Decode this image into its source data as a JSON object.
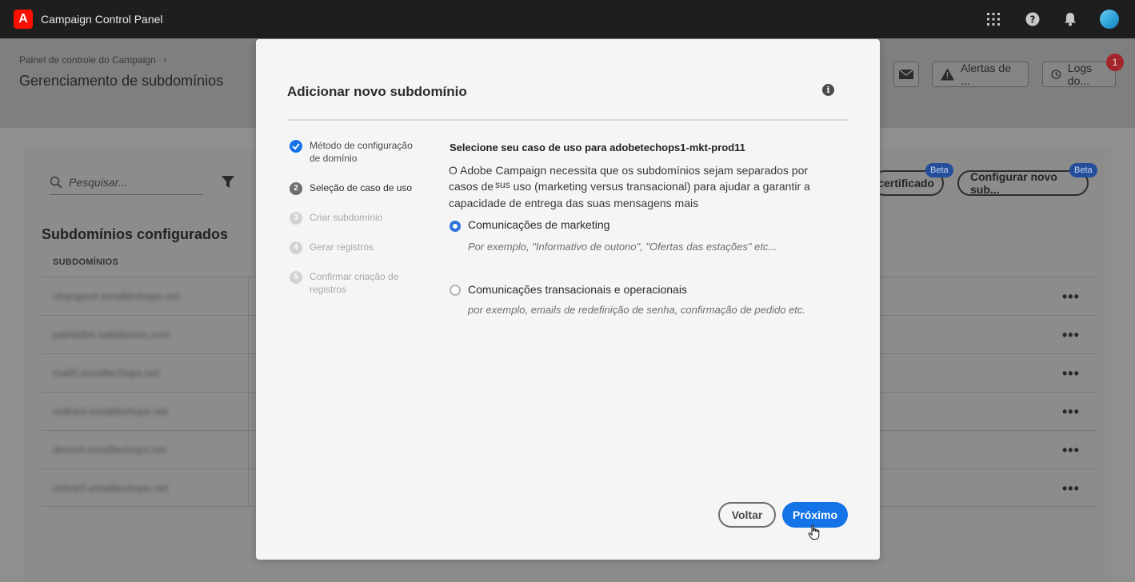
{
  "app": {
    "logo": "A",
    "title": "Campaign Control Panel"
  },
  "topbar_icons": [
    "apps-grid-icon",
    "help-icon",
    "bell-icon"
  ],
  "page": {
    "breadcrumb": "Painel de controle do Campaign",
    "title": "Gerenciamento de subdomínios",
    "header_buttons": {
      "alerts": "Alertas de ...",
      "logs": "Logs do..."
    },
    "logs_badge": "1"
  },
  "main": {
    "search_placeholder": "Pesquisar...",
    "cert_button": "certificado",
    "configure_button": "Configurar novo sub...",
    "beta_label": "Beta",
    "section_title": "Subdomínios configurados",
    "column_header": "SUBDOMÍNIOS",
    "rows": [
      "changes4.emailtechops.net",
      "patmidtst.sabtrbxxxx.com",
      "mail5.emailtechops.net",
      "online4.emailtechops.net",
      "demo4.emailtechops.net",
      "online5.emailtechops.net"
    ],
    "row_menu": "•••"
  },
  "dialog": {
    "title": "Adicionar novo subdomínio",
    "info_glyph": "i",
    "steps": [
      {
        "num": "✓",
        "label": "Método de configuração de domínio",
        "state": "done"
      },
      {
        "num": "2",
        "label": "Seleção de caso de uso",
        "state": "active"
      },
      {
        "num": "3",
        "label": "Criar subdomínio",
        "state": "pending"
      },
      {
        "num": "4",
        "label": "Gerar registros",
        "state": "pending"
      },
      {
        "num": "5",
        "label": "Confirmar criação de registros",
        "state": "pending"
      }
    ],
    "use_case_title": "Selecione seu caso de uso para adobetechops1-mkt-prod11",
    "use_case_desc_1": "O Adobe Campaign necessita que os subdomínios sejam separados por casos de",
    "use_case_desc_sus": "sus",
    "use_case_desc_2": "uso (marketing versus transacional) para ajudar a garantir a capacidade de entrega das suas mensagens mais",
    "options": [
      {
        "label": "Comunicações de marketing",
        "hint": "Por exemplo, \"Informativo de outono\", \"Ofertas das estações\" etc...",
        "selected": true
      },
      {
        "label": "Comunicações transacionais e operacionais",
        "hint": "por exemplo, emails de redefinição de senha, confirmação de pedido etc.",
        "selected": false
      }
    ],
    "back_button": "Voltar",
    "next_button": "Próximo"
  },
  "colors": {
    "accent": "#1473e6",
    "beta": "#244e9a",
    "badge": "#a3262a",
    "adobe_red": "#fa0f00"
  }
}
